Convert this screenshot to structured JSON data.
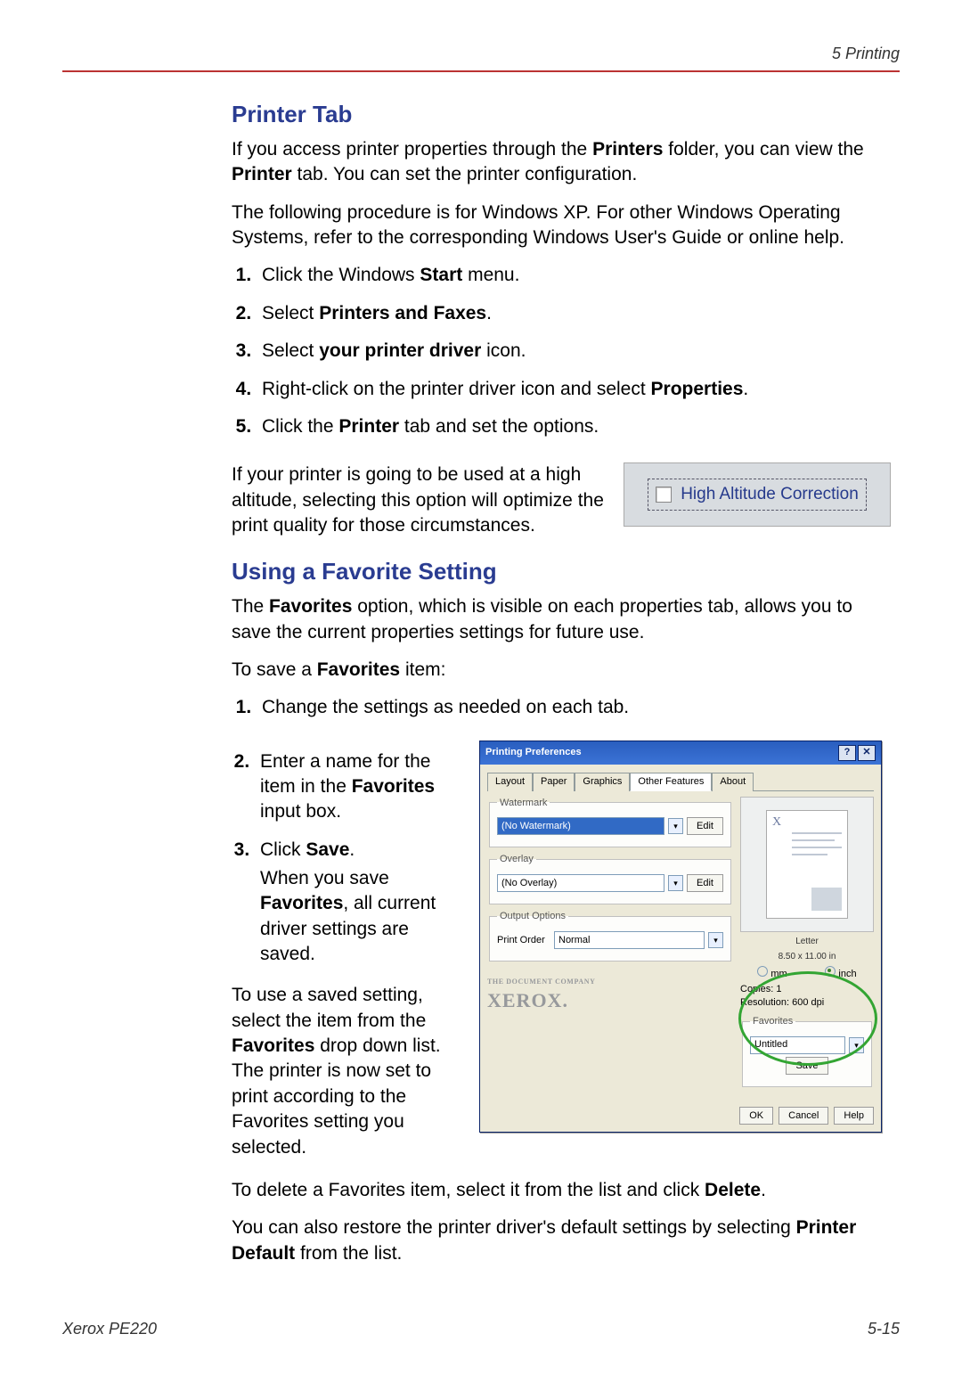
{
  "header": {
    "chapter": "5   Printing"
  },
  "section1": {
    "heading": "Printer Tab",
    "para1_pre": "If you access printer properties through the ",
    "para1_bold1": "Printers",
    "para1_mid": " folder, you can view the ",
    "para1_bold2": "Printer",
    "para1_post": " tab. You can set the printer configuration.",
    "para2": "The following procedure is for Windows XP. For other Windows Operating Systems, refer to the corresponding Windows User's Guide or online help.",
    "steps": {
      "s1a": "Click the Windows ",
      "s1b": "Start",
      "s1c": " menu.",
      "s2a": "Select ",
      "s2b": "Printers and Faxes",
      "s2c": ".",
      "s3a": "Select ",
      "s3b": "your printer driver",
      "s3c": " icon.",
      "s4a": "Right-click on the printer driver icon and select ",
      "s4b": "Properties",
      "s4c": ".",
      "s5a": "Click the ",
      "s5b": "Printer",
      "s5c": " tab and set the options."
    },
    "altitude_text": "If your printer is going to be used at a high altitude, selecting this option will optimize the print quality for those circumstances.",
    "altitude_checkbox_label": "High Altitude Correction"
  },
  "section2": {
    "heading": "Using a Favorite Setting",
    "para1a": "The ",
    "para1b": "Favorites",
    "para1c": " option, which is visible on each properties tab, allows you to save the current properties settings for future use.",
    "para2a": "To save a ",
    "para2b": "Favorites",
    "para2c": " item:",
    "ol1": "Change the settings as needed on each tab.",
    "left": {
      "s2a": "Enter a name for the item in the ",
      "s2b": "Favorites",
      "s2c": " input box.",
      "s3a": "Click ",
      "s3b": "Save",
      "s3c": ".",
      "s3da": "When you save ",
      "s3db": "Favorites",
      "s3dc": ", all current driver settings are saved."
    },
    "use_para_a": "To use a saved setting, select the item from the ",
    "use_para_b": "Favorites",
    "use_para_c": " drop down list. The printer is now set to print according to the Favorites setting you selected.",
    "para_delete_a": "To delete a Favorites item, select it from the list and click ",
    "para_delete_b": "Delete",
    "para_delete_c": ".",
    "para_default_a": "You can also restore the printer driver's default settings by selecting ",
    "para_default_b": "Printer Default",
    "para_default_c": " from the list."
  },
  "dialog": {
    "title": "Printing Preferences",
    "tabs": {
      "layout": "Layout",
      "paper": "Paper",
      "graphics": "Graphics",
      "other": "Other Features",
      "about": "About"
    },
    "watermark_group": "Watermark",
    "watermark_value": "(No Watermark)",
    "edit": "Edit",
    "overlay_group": "Overlay",
    "overlay_value": "(No Overlay)",
    "output_group": "Output Options",
    "print_order_label": "Print Order",
    "print_order_value": "Normal",
    "paper_name": "Letter",
    "paper_dims": "8.50 x 11.00 in",
    "unit_mm": "mm",
    "unit_inch": "inch",
    "copies": "Copies: 1",
    "resolution": "Resolution: 600 dpi",
    "favorites_group": "Favorites",
    "favorites_value": "Untitled",
    "save": "Save",
    "tdc": "THE DOCUMENT COMPANY",
    "brand": "XEROX.",
    "ok": "OK",
    "cancel": "Cancel",
    "help": "Help",
    "x_mark": "X"
  },
  "footer": {
    "left": "Xerox PE220",
    "right": "5-15"
  }
}
